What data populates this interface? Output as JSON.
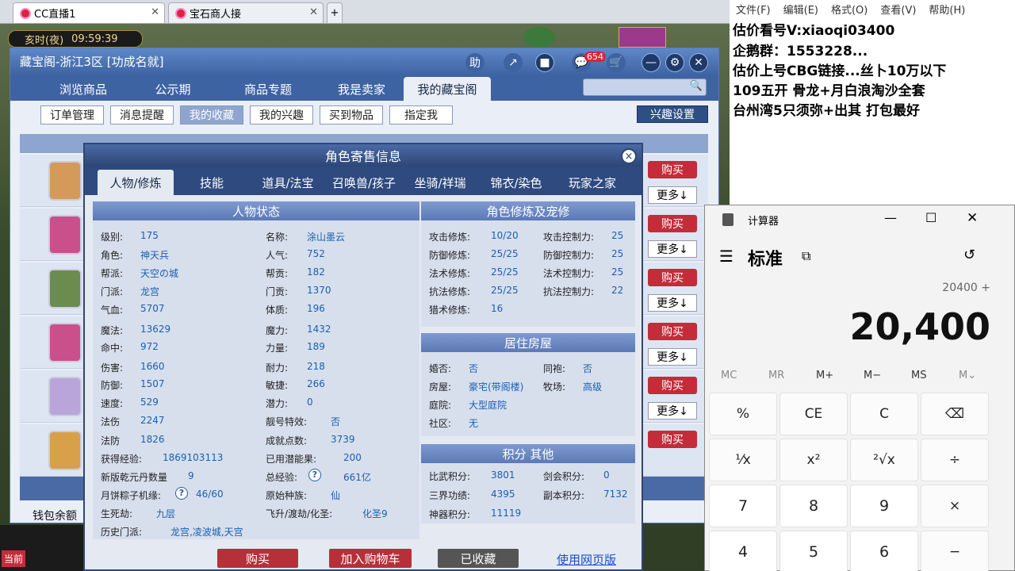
{
  "browser": {
    "tabs": [
      {
        "label": "CC直播1"
      },
      {
        "label": "宝石商人接"
      }
    ],
    "new_tab": "+"
  },
  "game": {
    "time_label": "亥时(夜)",
    "time": "09:59:39",
    "cart_badge": "654",
    "wallet_label": "钱包余额",
    "current_label": "当前"
  },
  "main": {
    "title": "藏宝阁-浙江3区 [功成名就]",
    "help": "助",
    "nav": [
      "浏览商品",
      "公示期",
      "商品专题",
      "我是卖家",
      "我的藏宝阁"
    ],
    "subtabs": [
      "订单管理",
      "消息提醒",
      "我的收藏",
      "我的兴趣",
      "买到物品",
      "指定我"
    ],
    "interest_btn": "兴趣设置",
    "buy": "购买",
    "more": "更多↓"
  },
  "dialog": {
    "title": "角色寄售信息",
    "close": "×",
    "tabs": [
      "人物/修炼",
      "技能",
      "道具/法宝",
      "召唤兽/孩子",
      "坐骑/祥瑞",
      "锦衣/染色",
      "玩家之家"
    ],
    "status_title": "人物状态",
    "status_left": [
      {
        "k": "级别:",
        "v": "175"
      },
      {
        "k": "角色:",
        "v": "神天兵"
      },
      {
        "k": "帮派:",
        "v": "天空の城"
      },
      {
        "k": "门派:",
        "v": "龙宫"
      },
      {
        "k": "气血:",
        "v": "5707"
      },
      {
        "k": "魔法:",
        "v": "13629"
      },
      {
        "k": "命中:",
        "v": "972"
      },
      {
        "k": "伤害:",
        "v": "1660"
      },
      {
        "k": "防御:",
        "v": "1507"
      },
      {
        "k": "速度:",
        "v": "529"
      },
      {
        "k": "法伤",
        "v": "2247"
      },
      {
        "k": "法防",
        "v": "1826"
      },
      {
        "k": "获得经验:",
        "v": "1869103113"
      },
      {
        "k": "新版乾元丹数量",
        "v": "9"
      },
      {
        "k": "月饼粽子机缘:",
        "v": "46/60"
      },
      {
        "k": "生死劫:",
        "v": "九层"
      },
      {
        "k": "历史门派:",
        "v": "龙宫,凌波城,天宫"
      }
    ],
    "status_right": [
      {
        "k": "名称:",
        "v": "涂山墨云"
      },
      {
        "k": "人气:",
        "v": "752"
      },
      {
        "k": "帮贡:",
        "v": "182"
      },
      {
        "k": "门贡:",
        "v": "1370"
      },
      {
        "k": "体质:",
        "v": "196"
      },
      {
        "k": "魔力:",
        "v": "1432"
      },
      {
        "k": "力量:",
        "v": "189"
      },
      {
        "k": "耐力:",
        "v": "218"
      },
      {
        "k": "敏捷:",
        "v": "266"
      },
      {
        "k": "潜力:",
        "v": "0"
      },
      {
        "k": "靓号特效:",
        "v": "否"
      },
      {
        "k": "成就点数:",
        "v": "3739"
      },
      {
        "k": "已用潜能果:",
        "v": "200"
      },
      {
        "k": "总经验:",
        "v": "661亿"
      },
      {
        "k": "原始种族:",
        "v": "仙"
      },
      {
        "k": "飞升/渡劫/化圣:",
        "v": "化圣9"
      }
    ],
    "cult_title": "角色修炼及宠修",
    "cult_left": [
      {
        "k": "攻击修炼:",
        "v": "10/20"
      },
      {
        "k": "防御修炼:",
        "v": "25/25"
      },
      {
        "k": "法术修炼:",
        "v": "25/25"
      },
      {
        "k": "抗法修炼:",
        "v": "25/25"
      },
      {
        "k": "猎术修炼:",
        "v": "16"
      }
    ],
    "cult_right": [
      {
        "k": "攻击控制力:",
        "v": "25"
      },
      {
        "k": "防御控制力:",
        "v": "25"
      },
      {
        "k": "法术控制力:",
        "v": "25"
      },
      {
        "k": "抗法控制力:",
        "v": "22"
      }
    ],
    "house_title": "居住房屋",
    "house": [
      {
        "k": "婚否:",
        "v": "否"
      },
      {
        "k": "同袍:",
        "v": "否"
      },
      {
        "k": "房屋:",
        "v": "豪宅(带阁楼)"
      },
      {
        "k": "牧场:",
        "v": "高级"
      },
      {
        "k": "庭院:",
        "v": "大型庭院"
      },
      {
        "k": "社区:",
        "v": "无"
      }
    ],
    "score_title": "积分 其他",
    "score": [
      {
        "k": "比武积分:",
        "v": "3801"
      },
      {
        "k": "剑会积分:",
        "v": "0"
      },
      {
        "k": "三界功绩:",
        "v": "4395"
      },
      {
        "k": "副本积分:",
        "v": "7132"
      },
      {
        "k": "神器积分:",
        "v": "11119"
      }
    ],
    "btn_buy": "购买",
    "btn_cart": "加入购物车",
    "btn_saved": "已收藏",
    "btn_web": "使用网页版"
  },
  "notepad": {
    "menu": [
      "文件(F)",
      "编辑(E)",
      "格式(O)",
      "查看(V)",
      "帮助(H)"
    ],
    "lines": [
      "估价看号V:xiaoqi03400",
      "企鹅群：1553228...",
      "估价上号CBG链接...丝卜10万以下",
      "109五开 骨龙+月白浪淘沙全套",
      "台州湾5只须弥+出其 打包最好"
    ]
  },
  "calc": {
    "title": "计算器",
    "mode": "标准",
    "expr": "20400 +",
    "display": "20,400",
    "mem": [
      "MC",
      "MR",
      "M+",
      "M−",
      "MS",
      "M⌄"
    ],
    "keys": [
      "%",
      "CE",
      "C",
      "⌫",
      "¹⁄x",
      "x²",
      "²√x",
      "÷",
      "7",
      "8",
      "9",
      "×",
      "4",
      "5",
      "6",
      "−"
    ]
  }
}
